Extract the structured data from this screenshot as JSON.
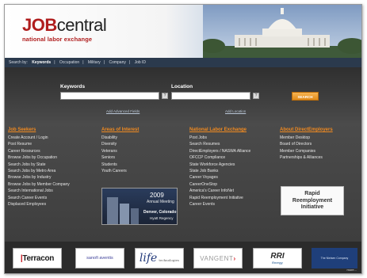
{
  "header": {
    "logo_main": "JOB",
    "logo_rest": "central",
    "logo_tagline": "national labor exchange"
  },
  "nav": {
    "label": "Search by:",
    "items": [
      "Keywords",
      "Occupation",
      "Military",
      "Company",
      "Job ID"
    ]
  },
  "search": {
    "keywords_label": "Keywords",
    "location_label": "Location",
    "help_glyph": "?",
    "button_label": "SEARCH",
    "advanced_link": "Add Advanced Fields",
    "location_link": "Add Location"
  },
  "columns": [
    {
      "heading": "Job Seekers",
      "items": [
        "Create Account / Login",
        "Post Resume",
        "Career Resources",
        "Browse Jobs by Occupation",
        "Search Jobs by State",
        "Search Jobs by Metro Area",
        "Browse Jobs by Industry",
        "Browse Jobs by Member Company",
        "Search International Jobs",
        "Search Career Events",
        "Displaced Employees"
      ]
    },
    {
      "heading": "Areas of Interest",
      "items": [
        "Disability",
        "Diversity",
        "Veterans",
        "Seniors",
        "Students",
        "Youth Careers"
      ]
    },
    {
      "heading": "National Labor Exchange",
      "items": [
        "Post Jobs",
        "Search Resumes",
        "DirectEmployers / NASWA Alliance",
        "OFCCP Compliance",
        "State Workforce Agencies",
        "State Job Banks",
        "Career Voyages",
        "CareerOneStop",
        "America's Career InfoNet",
        "Rapid Reemployment Initiative",
        "Career Events"
      ]
    },
    {
      "heading": "About DirectEmployers",
      "items": [
        "Member Desktop",
        "Board of Directors",
        "Member Companies",
        "Partnerships & Alliances"
      ]
    }
  ],
  "promo": {
    "year": "2009",
    "line1": "Annual Meeting",
    "line2": "Denver, Colorado",
    "line3": "Hyatt Regency"
  },
  "rri_box": {
    "line1": "Rapid",
    "line2": "Reemployment",
    "line3": "Initiative"
  },
  "partners": {
    "terracon_a": "",
    "terracon_b": "Terracon",
    "sanofi": "sanofi aventis",
    "life": "life",
    "life_sub": "technologies",
    "vangent": "VANGENT",
    "vangent_arrow": "›",
    "rri": "RRI",
    "rri_sub": "Energy",
    "blue_logo": "The Nielsen Company",
    "more": "more..."
  }
}
